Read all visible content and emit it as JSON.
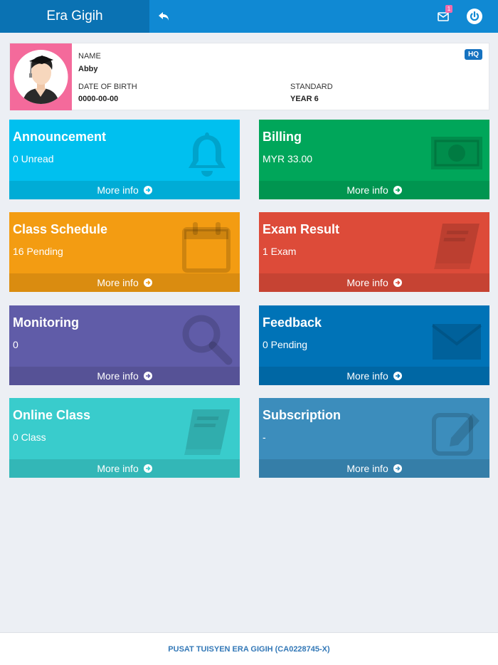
{
  "header": {
    "brand": "Era Gigih",
    "mail_count": "1"
  },
  "profile": {
    "name_label": "NAME",
    "name": "Abby",
    "dob_label": "DATE OF BIRTH",
    "dob": "0000-00-00",
    "standard_label": "STANDARD",
    "standard": "YEAR 6",
    "badge": "HQ",
    "avatar_bg": "#f46a9b"
  },
  "cards": [
    {
      "title": "Announcement",
      "subtitle": "0 Unread",
      "footer": "More info",
      "color": "#00c0ef",
      "icon": "bell-icon"
    },
    {
      "title": "Billing",
      "subtitle": "MYR 33.00",
      "footer": "More info",
      "color": "#00a65a",
      "icon": "money-icon"
    },
    {
      "title": "Class Schedule",
      "subtitle": "16 Pending",
      "footer": "More info",
      "color": "#f39c12",
      "icon": "calendar-icon"
    },
    {
      "title": "Exam Result",
      "subtitle": "1 Exam",
      "footer": "More info",
      "color": "#dd4b39",
      "icon": "book-icon"
    },
    {
      "title": "Monitoring",
      "subtitle": "0",
      "footer": "More info",
      "color": "#605ca8",
      "icon": "search-icon"
    },
    {
      "title": "Feedback",
      "subtitle": "0 Pending",
      "footer": "More info",
      "color": "#0073b7",
      "icon": "envelope-icon"
    },
    {
      "title": "Online Class",
      "subtitle": "0 Class",
      "footer": "More info",
      "color": "#39cccc",
      "icon": "book-icon"
    },
    {
      "title": "Subscription",
      "subtitle": "-",
      "footer": "More info",
      "color": "#3c8dbc",
      "icon": "edit-icon"
    }
  ],
  "footer": {
    "text": "PUSAT TUISYEN ERA GIGIH (CA0228745-X)"
  }
}
